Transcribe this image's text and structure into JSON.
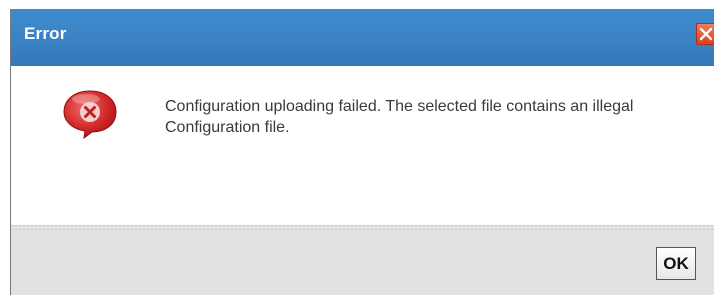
{
  "dialog": {
    "title": "Error",
    "message": "Configuration uploading failed. The selected file contains an illegal Configuration file.",
    "ok_label": "OK",
    "colors": {
      "titlebar": "#3a82c4",
      "close": "#d9421f",
      "error_icon": "#d42a2a",
      "footer": "#e2e2e2"
    },
    "icons": {
      "close": "close-icon",
      "status": "error-icon"
    }
  }
}
